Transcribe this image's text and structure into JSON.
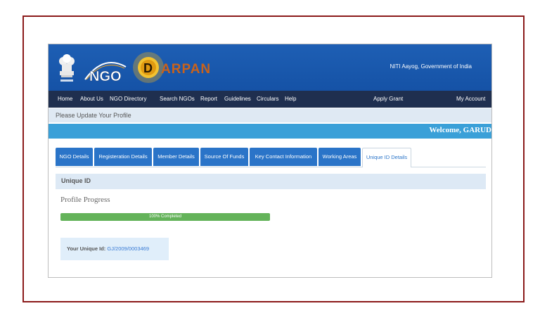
{
  "header": {
    "ngo_logo_text": "NGO",
    "darpan_logo_text": "ARPAN",
    "darpan_logo_letter": "D",
    "org_text": "NITI Aayog, Government of India"
  },
  "nav": {
    "items": [
      "Home",
      "About Us",
      "NGO Directory",
      "Search NGOs",
      "Report",
      "Guidelines",
      "Circulars",
      "Help"
    ],
    "apply_grant": "Apply Grant",
    "my_account": "My Account"
  },
  "notice": "Please Update Your Profile",
  "welcome": "Welcome, GARUD",
  "tabs": [
    {
      "label": "NGO Details"
    },
    {
      "label": "Registeration Details"
    },
    {
      "label": "Member Details"
    },
    {
      "label": "Source Of Funds"
    },
    {
      "label": "Key Contact Information"
    },
    {
      "label": "Working Areas"
    },
    {
      "label": "Unique ID Details"
    }
  ],
  "active_tab": "Unique ID Details",
  "section_title": "Unique ID",
  "profile": {
    "title": "Profile Progress",
    "progress_percent": 100,
    "progress_text": "100% Completed"
  },
  "unique_id": {
    "label": "Your Unique Id:",
    "value": "GJ/2009/0003469"
  },
  "colors": {
    "header_blue": "#1e5fb4",
    "nav_dark": "#1f2f4f",
    "welcome_bar": "#3aa0d8",
    "tab_blue": "#2a74c8",
    "progress_green": "#64b35a",
    "frame_border": "#8b1a1a"
  }
}
